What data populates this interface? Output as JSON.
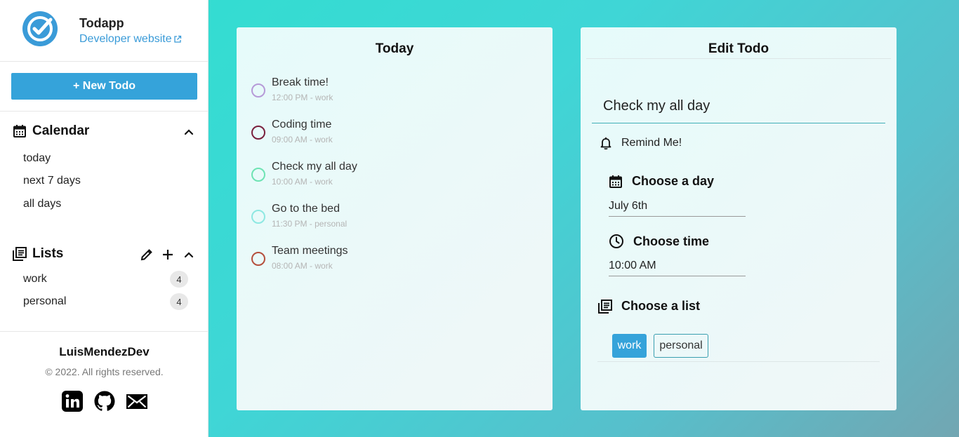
{
  "app": {
    "name": "Todapp",
    "developer_link": "Developer website"
  },
  "sidebar": {
    "new_todo_label": "+ New Todo",
    "calendar": {
      "title": "Calendar",
      "items": [
        "today",
        "next 7 days",
        "all days"
      ]
    },
    "lists": {
      "title": "Lists",
      "items": [
        {
          "name": "work",
          "count": "4"
        },
        {
          "name": "personal",
          "count": "4"
        }
      ]
    },
    "footer": {
      "author": "LuisMendezDev",
      "copyright": "© 2022. All rights reserved."
    },
    "social_icons": [
      "linkedin-icon",
      "github-icon",
      "mail-icon"
    ]
  },
  "today": {
    "title": "Today",
    "todos": [
      {
        "title": "Break time!",
        "meta": "12:00 PM - work",
        "color": "#b69ad8"
      },
      {
        "title": "Coding time",
        "meta": "09:00 AM - work",
        "color": "#7a1f3d"
      },
      {
        "title": "Check my all day",
        "meta": "10:00 AM - work",
        "color": "#6ee3b4"
      },
      {
        "title": "Go to the bed",
        "meta": "11:30 PM - personal",
        "color": "#8ee8e2"
      },
      {
        "title": "Team meetings",
        "meta": "08:00 AM - work",
        "color": "#b5503d"
      }
    ]
  },
  "edit": {
    "title": "Edit Todo",
    "todo_title_value": "Check my all day",
    "remind_label": "Remind Me!",
    "day": {
      "label": "Choose a day",
      "value": "July 6th"
    },
    "time": {
      "label": "Choose time",
      "value": "10:00 AM"
    },
    "list": {
      "label": "Choose a list",
      "options": [
        "work",
        "personal"
      ],
      "selected": "work"
    }
  },
  "colors": {
    "accent": "#35a3da",
    "link": "#3a9bd8"
  }
}
